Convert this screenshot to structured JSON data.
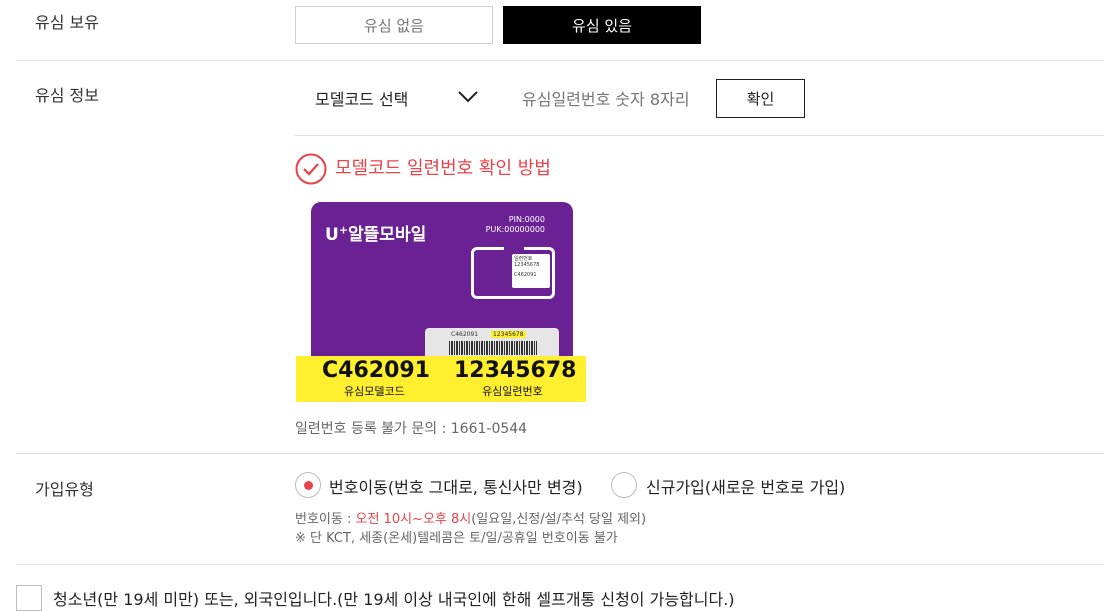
{
  "usim_possession": {
    "label": "유심 보유",
    "options": [
      "유심 없음",
      "유심 있음"
    ],
    "selected": "유심 있음"
  },
  "usim_info": {
    "label": "유심 정보",
    "model_select": "모델코드 선택",
    "serial_placeholder": "유심일련번호 숫자 8자리",
    "confirm_label": "확인",
    "help_title": "모델코드 일련번호 확인 방법",
    "card": {
      "brand_u": "U",
      "brand_plus": "+",
      "brand_name": "알뜰모바일",
      "pin": "PIN:0000",
      "puk": "PUK:00000000",
      "mini_label": "일련번호",
      "mini_serial": "12345678",
      "mini_code": "C462091",
      "barcode_model": "C462091",
      "barcode_serial": "12345678",
      "model_code": "C462091",
      "model_code_label": "유심모델코드",
      "serial": "12345678",
      "serial_label": "유심일련번호"
    },
    "inquiry_text": "일련번호 등록 불가 문의 : 1661-0544"
  },
  "join_type": {
    "label": "가입유형",
    "options": [
      "번호이동(번호 그대로, 통신사만 변경)",
      "신규가입(새로운 번호로 가입)"
    ],
    "selected_index": 0,
    "note_prefix": "번호이동 : ",
    "note_hours": "오전 10시~오후 8시",
    "note_suffix": "(일요일,신정/설/추석 당일 제외)",
    "note2": "※ 단 KCT, 세종(온세)텔레콤은 토/일/공휴일 번호이동 불가"
  },
  "minor_check": {
    "label": "청소년(만 19세 미만) 또는, 외국인입니다.(만 19세 이상 내국인에 한해 셀프개통 신청이 가능합니다.)",
    "checked": false
  },
  "colors": {
    "accent": "#e8424a",
    "card_purple": "#6a2194",
    "yellow": "#ffef2f"
  }
}
